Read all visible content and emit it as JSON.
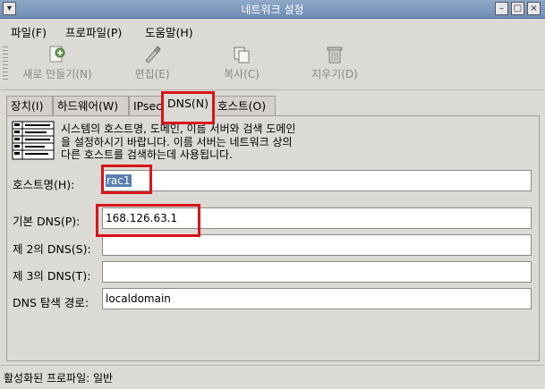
{
  "window": {
    "title": "네트워크 설정"
  },
  "menu": [
    {
      "label": "파일(F)"
    },
    {
      "label": "프로파일(P)"
    },
    {
      "label": "도움말(H)"
    }
  ],
  "toolbar": [
    {
      "label": "새로 만들기(N)",
      "icon": "new-icon"
    },
    {
      "label": "편집(E)",
      "icon": "edit-icon"
    },
    {
      "label": "복사(C)",
      "icon": "copy-icon"
    },
    {
      "label": "지우기(D)",
      "icon": "trash-icon"
    }
  ],
  "tabs": [
    {
      "label": "장치(I)"
    },
    {
      "label": "하드웨어(W)"
    },
    {
      "label": "IPsec"
    },
    {
      "label": "DNS(N)"
    },
    {
      "label": "호스트(O)"
    }
  ],
  "dns_tab": {
    "description_lines": [
      "시스템의 호스트명, 도메인, 이름 서버와 검색 도메인",
      "을 설정하시기 바랍니다. 이름 서버는 네트워크 상의",
      "다른 호스트를 검색하는데 사용됩니다."
    ],
    "hostname_label": "호스트명(H):",
    "hostname_value": "rac1",
    "primary_dns_label": "기본 DNS(P):",
    "primary_dns_value": "168.126.63.1",
    "secondary_dns_label": "제 2의 DNS(S):",
    "secondary_dns_value": "",
    "tertiary_dns_label": "제 3의 DNS(T):",
    "tertiary_dns_value": "",
    "search_path_label": "DNS 탐색 경로:",
    "search_path_value": "localdomain"
  },
  "status": {
    "text": "활성화된 프로파일: 일반"
  },
  "colors": {
    "highlight": "#d8141a",
    "selection": "#5a7fb0"
  }
}
